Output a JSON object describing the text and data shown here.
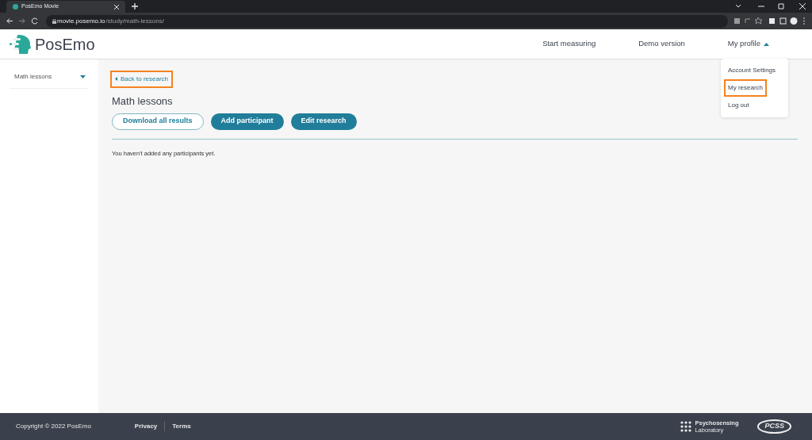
{
  "browser": {
    "tab_title": "PosEmo Movie",
    "url_host": "movie.posemo.io",
    "url_path": "/study/math-lessons/"
  },
  "header": {
    "logo": "PosEmo",
    "nav": [
      {
        "label": "Start measuring",
        "kind": "link"
      },
      {
        "label": "Demo version",
        "kind": "link"
      },
      {
        "label": "My profile",
        "kind": "dropdown",
        "expanded": true
      }
    ]
  },
  "profile_menu": [
    {
      "label": "Account Settings",
      "highlighted": false
    },
    {
      "label": "My research",
      "highlighted": true
    },
    {
      "label": "Log out",
      "highlighted": false
    }
  ],
  "sidebar": {
    "items": [
      {
        "label": "Math lessons",
        "expanded": false
      }
    ]
  },
  "main": {
    "back_link": {
      "label": "Back to research",
      "highlighted": true
    },
    "title": "Math lessons",
    "buttons": [
      {
        "label": "Download all results",
        "kind": "outline"
      },
      {
        "label": "Add participant",
        "kind": "filled"
      },
      {
        "label": "Edit research",
        "kind": "filled"
      }
    ],
    "empty_message": "You haven't added any participants yet."
  },
  "footer": {
    "copyright": "Copyright © 2022 PosEmo",
    "links": [
      "Privacy",
      "Terms"
    ],
    "lab_logo": [
      "Psychosensing",
      "Laboratory"
    ],
    "pcss_logo": "PCSS"
  }
}
